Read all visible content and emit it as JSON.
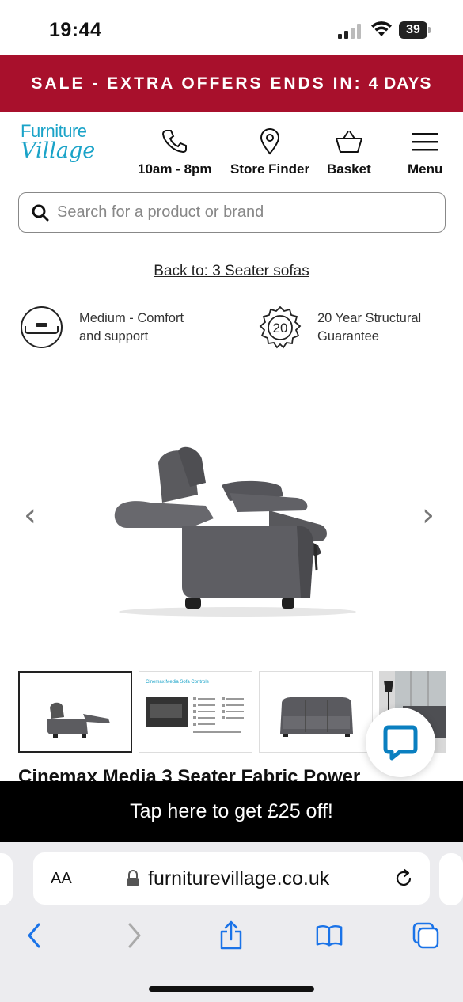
{
  "status_bar": {
    "time": "19:44",
    "battery": "39"
  },
  "sale_banner": {
    "text": "SALE - EXTRA OFFERS ENDS IN:",
    "days": "4 DAYS"
  },
  "logo": {
    "line1": "Furniture",
    "line2": "Village"
  },
  "header_nav": [
    {
      "label": "10am - 8pm",
      "icon": "phone-icon"
    },
    {
      "label": "Store Finder",
      "icon": "location-pin-icon"
    },
    {
      "label": "Basket",
      "icon": "basket-icon"
    },
    {
      "label": "Menu",
      "icon": "hamburger-menu-icon"
    }
  ],
  "search": {
    "placeholder": "Search for a product or brand"
  },
  "back_link": "Back to: 3 Seater sofas",
  "features": [
    {
      "line1": "Medium - Comfort",
      "line2": "and support",
      "icon": "seat-comfort-icon"
    },
    {
      "line1": "20 Year Structural",
      "line2": "Guarantee",
      "icon": "guarantee-badge-icon",
      "badge": "20"
    }
  ],
  "gallery": {
    "prev_arrow": "‹",
    "next_arrow": "›",
    "thumbnail_caption": "Cinemax Media Sofa Controls"
  },
  "product": {
    "title": "Cinemax Media 3 Seater Fabric Power"
  },
  "promo": {
    "text": "Tap here to get £25 off!"
  },
  "browser": {
    "aa_label": "AA",
    "url": "furniturevillage.co.uk"
  },
  "colors": {
    "brand_red": "#a8102c",
    "brand_blue": "#1aa3c8",
    "chat_blue": "#0a7fc0"
  }
}
